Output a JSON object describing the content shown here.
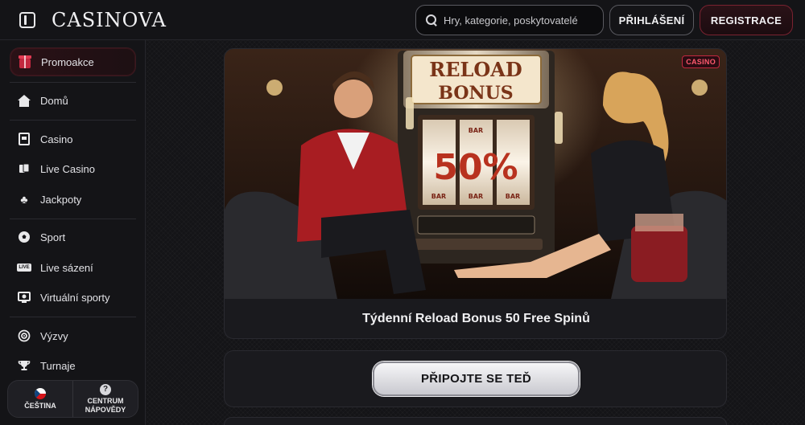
{
  "header": {
    "logo_text": "CASINOVA",
    "search_placeholder": "Hry, kategorie, poskytovatelé",
    "login_label": "PŘIHLÁŠENÍ",
    "register_label": "REGISTRACE"
  },
  "sidebar": {
    "items": [
      {
        "label": "Promoakce",
        "icon": "gift-icon"
      },
      {
        "label": "Domů",
        "icon": "home-icon"
      },
      {
        "label": "Casino",
        "icon": "slot-machine-icon"
      },
      {
        "label": "Live Casino",
        "icon": "live-casino-icon"
      },
      {
        "label": "Jackpoty",
        "icon": "clover-icon"
      },
      {
        "label": "Sport",
        "icon": "soccer-ball-icon"
      },
      {
        "label": "Live sázení",
        "icon": "live-icon"
      },
      {
        "label": "Virtuální sporty",
        "icon": "virtual-sports-icon"
      },
      {
        "label": "Výzvy",
        "icon": "target-icon"
      },
      {
        "label": "Turnaje",
        "icon": "trophy-icon"
      }
    ],
    "language_label": "ČEŠTINA",
    "help_label_line1": "CENTRUM",
    "help_label_line2": "NÁPOVĚDY"
  },
  "promo": {
    "badge": "CASINO",
    "banner_line1": "RELOAD",
    "banner_line2": "BONUS",
    "banner_percent": "50%",
    "reel_label_1": "BAR",
    "reel_label_2": "BAR",
    "reel_label_3": "BAR",
    "reel_label_4": "BAR",
    "title": "Týdenní Reload Bonus 50 Free Spinů",
    "cta_label": "PŘIPOJTE SE TEĎ"
  },
  "colors": {
    "accent": "#c2283f",
    "background": "#141417",
    "card": "#1a1a1e"
  }
}
